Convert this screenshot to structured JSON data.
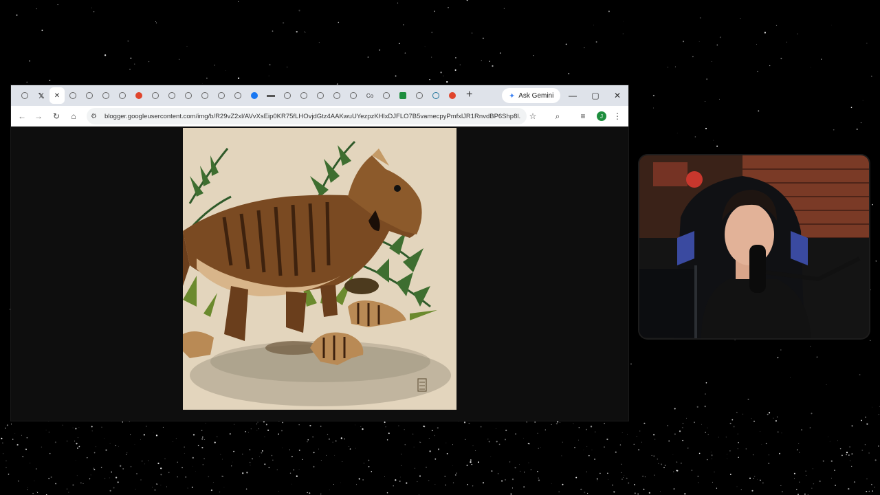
{
  "browser": {
    "tabs": [
      {
        "icon": "globe-icon"
      },
      {
        "icon": "x-logo-icon"
      },
      {
        "icon": "close-icon",
        "active": true
      },
      {
        "icon": "globe-icon"
      },
      {
        "icon": "globe-icon"
      },
      {
        "icon": "globe-icon"
      },
      {
        "icon": "globe-icon"
      },
      {
        "icon": "reddit-icon"
      },
      {
        "icon": "globe-icon"
      },
      {
        "icon": "globe-icon"
      },
      {
        "icon": "globe-icon"
      },
      {
        "icon": "globe-icon"
      },
      {
        "icon": "globe-icon"
      },
      {
        "icon": "globe-icon"
      },
      {
        "icon": "facebook-icon"
      },
      {
        "icon": "dash-icon"
      },
      {
        "icon": "globe-icon"
      },
      {
        "icon": "globe-icon"
      },
      {
        "icon": "globe-icon"
      },
      {
        "icon": "globe-icon"
      },
      {
        "icon": "globe-icon"
      },
      {
        "icon": "co-icon"
      },
      {
        "icon": "globe-icon"
      },
      {
        "icon": "sheets-icon"
      },
      {
        "icon": "globe-icon"
      },
      {
        "icon": "wordpress-icon"
      },
      {
        "icon": "reddit-icon"
      }
    ],
    "ask_gemini_label": "Ask Gemini",
    "url": "blogger.googleusercontent.com/img/b/R29vZ2xl/AVvXsEip0KR75fLHOvjdGtz4AAKwuUYezpzKHlxDJFLO7B5vamecpyPmfxlJR1RnvdBP6Shp8l...",
    "profile_initial": "J"
  },
  "colors": {
    "tabstrip": "#dfe3ea",
    "omnibox": "#f1f3f4",
    "image_background": "#e3d5bd",
    "dino_body": "#7a4a22",
    "profile": "#1e8e3e"
  }
}
